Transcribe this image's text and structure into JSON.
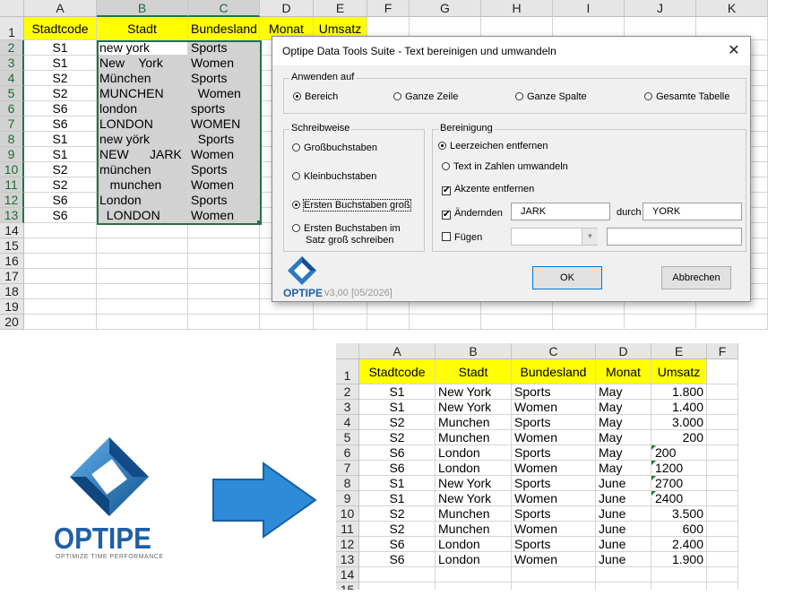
{
  "sheet1": {
    "col_letters": [
      "A",
      "B",
      "C",
      "D",
      "E",
      "F",
      "G",
      "H",
      "I",
      "J",
      "K"
    ],
    "row_numbers": [
      "1",
      "2",
      "3",
      "4",
      "5",
      "6",
      "7",
      "8",
      "9",
      "10",
      "11",
      "12",
      "13",
      "14",
      "15",
      "16",
      "17",
      "18",
      "19",
      "20"
    ],
    "headers": [
      "Stadtcode",
      "Stadt",
      "Bundesland",
      "Monat",
      "Umsatz"
    ],
    "rows": [
      [
        "S1",
        "new york",
        "Sports"
      ],
      [
        "S1",
        "New    York",
        "Women"
      ],
      [
        "S2",
        "München",
        "Sports"
      ],
      [
        "S2",
        "MUNCHEN",
        "  Women"
      ],
      [
        "S6",
        "london",
        "sports"
      ],
      [
        "S6",
        "LONDON",
        "WOMEN"
      ],
      [
        "S1",
        "new yörk",
        "  Sports"
      ],
      [
        "S1",
        "NEW      JARK",
        "Women"
      ],
      [
        "S2",
        "münchen",
        "Sports"
      ],
      [
        "S2",
        "   munchen",
        "Women"
      ],
      [
        "S6",
        "London",
        "Sports"
      ],
      [
        "S6",
        "  LONDON",
        "Women"
      ]
    ]
  },
  "dialog": {
    "title": "Optipe Data Tools Suite - Text bereinigen und umwandeln",
    "close": "✕",
    "apply_to": {
      "label": "Anwenden auf",
      "options": [
        "Bereich",
        "Ganze Zeile",
        "Ganze Spalte",
        "Gesamte Tabelle"
      ],
      "selected": "Bereich"
    },
    "case": {
      "label": "Schreibweise",
      "options": [
        "Großbuchstaben",
        "Kleinbuchstaben",
        "Ersten Buchstaben groß",
        "Ersten Buchstaben im",
        "Satz groß schreiben"
      ],
      "selected": "Ersten Buchstaben groß"
    },
    "clean": {
      "label": "Bereinigung",
      "remove_spaces": "Leerzeichen entfernen",
      "text_to_numbers": "Text in Zahlen umwandeln",
      "remove_accents": "Akzente entfernen",
      "replace_label": "Ändernden",
      "replace_from": "JARK",
      "replace_by_label": "durch",
      "replace_to": "YORK",
      "add_label": "Fügen",
      "add_select": "",
      "add_text": ""
    },
    "ok": "OK",
    "cancel": "Abbrechen",
    "version": "v3,00 [05/2026]",
    "brand": "OPTIPE"
  },
  "sheet2": {
    "col_letters": [
      "A",
      "B",
      "C",
      "D",
      "E",
      "F"
    ],
    "row_numbers": [
      "1",
      "2",
      "3",
      "4",
      "5",
      "6",
      "7",
      "8",
      "9",
      "10",
      "11",
      "12",
      "13",
      "14",
      "15"
    ],
    "headers": [
      "Stadtcode",
      "Stadt",
      "Bundesland",
      "Monat",
      "Umsatz"
    ],
    "rows": [
      [
        "S1",
        "New York",
        "Sports",
        "May",
        "1.800"
      ],
      [
        "S1",
        "New York",
        "Women",
        "May",
        "1.400"
      ],
      [
        "S2",
        "Munchen",
        "Sports",
        "May",
        "3.000"
      ],
      [
        "S2",
        "Munchen",
        "Women",
        "May",
        "200"
      ],
      [
        "S6",
        "London",
        "Sports",
        "May",
        "200"
      ],
      [
        "S6",
        "London",
        "Women",
        "May",
        "1200"
      ],
      [
        "S1",
        "New York",
        "Sports",
        "June",
        "2700"
      ],
      [
        "S1",
        "New York",
        "Women",
        "June",
        "2400"
      ],
      [
        "S2",
        "Munchen",
        "Sports",
        "June",
        "3.500"
      ],
      [
        "S2",
        "Munchen",
        "Women",
        "June",
        "600"
      ],
      [
        "S6",
        "London",
        "Sports",
        "June",
        "2.400"
      ],
      [
        "S6",
        "London",
        "Women",
        "June",
        "1.900"
      ]
    ],
    "text_number_rows": [
      5,
      6,
      7,
      8
    ]
  },
  "logo": {
    "name": "OPTIPE",
    "tagline": "OPTIMIZE TIME PERFORMANCE"
  },
  "colors": {
    "header_yellow": "#ffff00",
    "selection_green": "#217346",
    "logo_blue": "#1f5fa8",
    "arrow_blue": "#2e8bd8"
  }
}
